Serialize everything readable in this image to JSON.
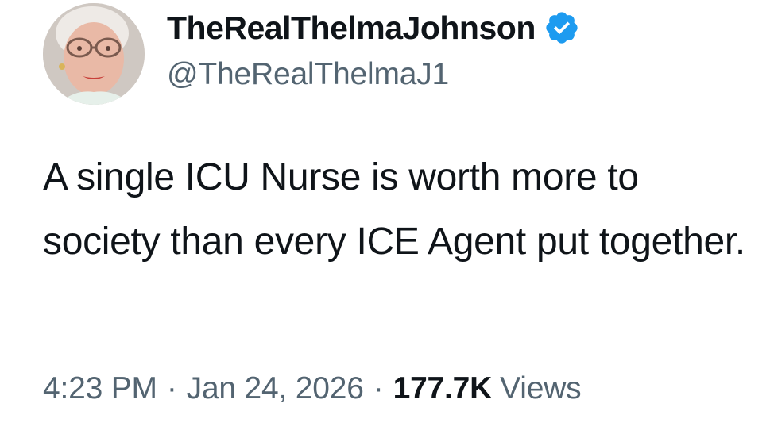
{
  "author": {
    "display_name": "TheRealThelmaJohnson",
    "handle": "@TheRealThelmaJ1",
    "verified_icon": "verified-badge-icon",
    "verified_color": "#1d9bf0"
  },
  "tweet": {
    "text": "A single ICU Nurse is worth more to society than every ICE Agent put together."
  },
  "meta": {
    "time": "4:23 PM",
    "separator": "·",
    "date": "Jan 24, 2026",
    "views_count": "177.7K",
    "views_label": "Views"
  },
  "colors": {
    "text_primary": "#0f1419",
    "text_secondary": "#536471",
    "background": "#ffffff"
  }
}
